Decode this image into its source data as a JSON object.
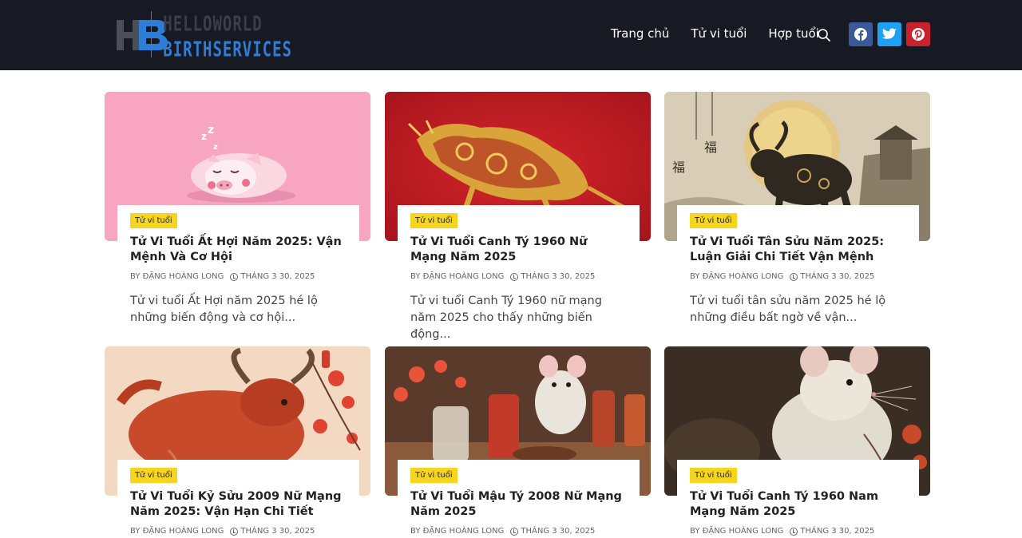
{
  "logo": {
    "line1": "HELLOWORLD",
    "line2": "BIRTHSERVICES",
    "mark": "HB"
  },
  "nav": {
    "items": [
      "Trang chủ",
      "Tử vi tuổi",
      "Hợp tuổi"
    ]
  },
  "icons": {
    "search": "search-icon",
    "facebook": "facebook-icon",
    "twitter": "twitter-icon",
    "pinterest": "pinterest-icon"
  },
  "colors": {
    "header_bg": "#171a22",
    "badge": "#f6d51f",
    "brand_blue": "#2e7dd6"
  },
  "posts": [
    {
      "category": "Tử vi tuổi",
      "title": "Tử Vi Tuổi Ất Hợi Năm 2025: Vận Mệnh Và Cơ Hội",
      "author": "BY ĐẶNG HOÀNG LONG",
      "date": "THÁNG 3 30, 2025",
      "excerpt": "Tử vi tuổi Ất Hợi năm 2025 hé lộ những biến động và cơ hội..."
    },
    {
      "category": "Tử vi tuổi",
      "title": "Tử Vi Tuổi Canh Tý 1960 Nữ Mạng Năm 2025",
      "author": "BY ĐẶNG HOÀNG LONG",
      "date": "THÁNG 3 30, 2025",
      "excerpt": "Tử vi tuổi Canh Tý 1960 nữ mạng năm 2025 cho thấy những biến động..."
    },
    {
      "category": "Tử vi tuổi",
      "title": "Tử Vi Tuổi Tân Sửu Năm 2025: Luận Giải Chi Tiết Vận Mệnh",
      "author": "BY ĐẶNG HOÀNG LONG",
      "date": "THÁNG 3 30, 2025",
      "excerpt": "Tử vi tuổi tân sửu năm 2025 hé lộ những điều bất ngờ về vận..."
    },
    {
      "category": "Tử vi tuổi",
      "title": "Tử Vi Tuổi Kỷ Sửu 2009 Nữ Mạng Năm 2025: Vận Hạn Chi Tiết",
      "author": "BY ĐẶNG HOÀNG LONG",
      "date": "THÁNG 3 30, 2025",
      "excerpt": ""
    },
    {
      "category": "Tử vi tuổi",
      "title": "Tử Vi Tuổi Mậu Tý 2008 Nữ Mạng Năm 2025",
      "author": "BY ĐẶNG HOÀNG LONG",
      "date": "THÁNG 3 30, 2025",
      "excerpt": ""
    },
    {
      "category": "Tử vi tuổi",
      "title": "Tử Vi Tuổi Canh Tý 1960 Nam Mạng Năm 2025",
      "author": "BY ĐẶNG HOÀNG LONG",
      "date": "THÁNG 3 30, 2025",
      "excerpt": ""
    }
  ]
}
